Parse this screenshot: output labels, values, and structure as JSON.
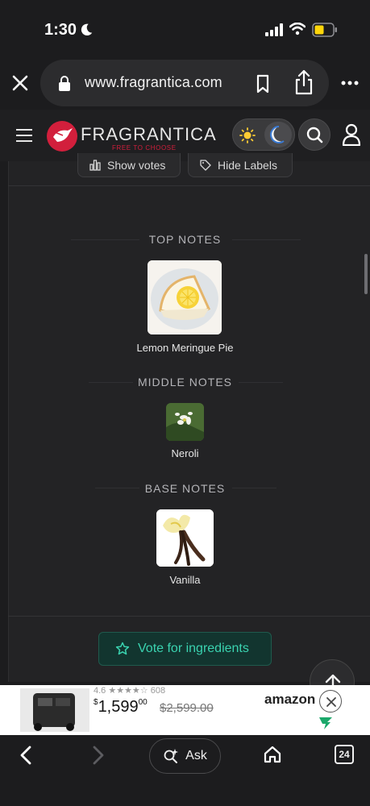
{
  "status_bar": {
    "time": "1:30"
  },
  "browser": {
    "url": "www.fragrantica.com",
    "tab_count": "24",
    "ask_label": "Ask"
  },
  "site": {
    "logo_text": "FRAGRANTICA",
    "logo_tagline": "FREE TO CHOOSE",
    "brand_color": "#d21f3c"
  },
  "toolbar_buttons": {
    "show_votes": "Show votes",
    "hide_labels": "Hide Labels"
  },
  "pyramid": {
    "top": {
      "label": "TOP NOTES",
      "notes": [
        {
          "name": "Lemon Meringue Pie",
          "icon": "lemon-meringue-pie-image"
        }
      ]
    },
    "middle": {
      "label": "MIDDLE NOTES",
      "notes": [
        {
          "name": "Neroli",
          "icon": "neroli-flower-image"
        }
      ]
    },
    "base": {
      "label": "BASE NOTES",
      "notes": [
        {
          "name": "Vanilla",
          "icon": "vanilla-flower-image"
        }
      ]
    }
  },
  "vote_button": {
    "label": "Vote for ingredients",
    "color": "#3ad3b0"
  },
  "ad": {
    "rating_text": "4.6 ★★★★☆ 608",
    "price_main": "1,599",
    "price_cents": "00",
    "price_currency": "$",
    "old_price": "$2,599.00",
    "vendor": "amazon"
  }
}
